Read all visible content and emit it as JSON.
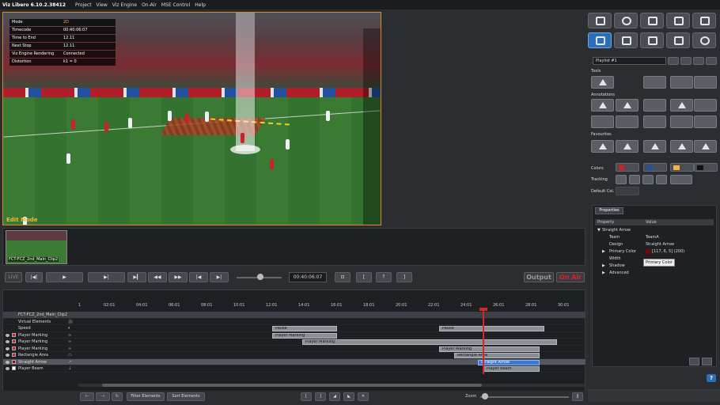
{
  "app": {
    "title": "Viz Libero 6.10.2.38412",
    "menu": [
      "Project",
      "View",
      "Viz Engine",
      "On-Air",
      "MSE Control",
      "Help"
    ]
  },
  "video": {
    "overlay_label": "Edit Mode",
    "info": [
      {
        "key": "Mode",
        "value": "2D"
      },
      {
        "key": "Timecode",
        "value": "00:40:06:07"
      },
      {
        "key": "Time to End",
        "value": "12.11"
      },
      {
        "key": "Next Stop",
        "value": "12.11"
      },
      {
        "key": "Viz Engine Rendering",
        "value": "Connected"
      },
      {
        "key": "Distortion",
        "value": "k1 = 0"
      }
    ]
  },
  "thumbnails": [
    {
      "label": "FCT-FCZ_2nd_Main_Clip2"
    }
  ],
  "transport": {
    "live": "LIVE",
    "timecode": "00:40:06:07",
    "output": "Output",
    "on_air": "On Air"
  },
  "timeline": {
    "ticks": [
      "1",
      "02:01",
      "04:01",
      "06:01",
      "08:01",
      "10:01",
      "12:01",
      "14:01",
      "16:01",
      "18:01",
      "20:01",
      "22:01",
      "24:01",
      "26:01",
      "28:01",
      "30:01"
    ],
    "tracks": [
      {
        "label": "FCT-FCZ_2nd_Main_Clip2",
        "type": "header"
      },
      {
        "label": "Virtual Elements",
        "icon": "🎥"
      },
      {
        "label": "Speed",
        "icon": "⏸"
      },
      {
        "label": "Player Marking",
        "icon": "∞",
        "color": "#c8222a"
      },
      {
        "label": "Player Marking",
        "icon": "∞",
        "color": "#c8222a"
      },
      {
        "label": "Player Marking",
        "icon": "∞",
        "color": "#c8222a"
      },
      {
        "label": "Rectangle Area",
        "icon": "▭",
        "color": "#c8222a"
      },
      {
        "label": "Straight Arrow",
        "icon": "↗",
        "color": "#8b1010",
        "selected": true
      },
      {
        "label": "Player Beam",
        "icon": "⇣",
        "color": "#ffffff"
      }
    ],
    "clips": [
      {
        "track": 2,
        "label": "Pause"
      },
      {
        "track": 2,
        "label": "Pause"
      },
      {
        "track": 3,
        "label": "Player Marking"
      },
      {
        "track": 4,
        "label": "Player Marking"
      },
      {
        "track": 5,
        "label": "Player Marking"
      },
      {
        "track": 6,
        "label": "Rectangle Area"
      },
      {
        "track": 7,
        "label": "Straight Arrow",
        "selected": true
      },
      {
        "track": 8,
        "label": "Player Beam"
      }
    ]
  },
  "bottombar": {
    "filter": "Filter Elements",
    "sort": "Sort Elements",
    "zoom": "Zoom"
  },
  "rpanel": {
    "playlist": "Playlist #1",
    "sections": {
      "tools": "Tools",
      "annotations": "Annotations",
      "favourites": "Favourites",
      "colors": "Colors",
      "tracking": "Tracking",
      "default_col": "Default Col."
    },
    "properties": {
      "tab": "Properties",
      "col_property": "Property",
      "col_value": "Value",
      "rows": [
        {
          "name": "Straight Arrow",
          "value": "",
          "level": 0,
          "expand": "▼"
        },
        {
          "name": "Team",
          "value": "TeamA",
          "level": 1
        },
        {
          "name": "Design",
          "value": "Straight Arrow",
          "level": 1
        },
        {
          "name": "Primary Color",
          "value": "[117, 6, 5] (200)",
          "level": 1,
          "expand": "▶",
          "swatch": "#750605"
        },
        {
          "name": "Width",
          "value": "",
          "level": 1
        },
        {
          "name": "Shadow",
          "value": "",
          "level": 1,
          "expand": "▶"
        },
        {
          "name": "Advanced",
          "value": "",
          "level": 1,
          "expand": "▶"
        }
      ],
      "tooltip": "Primary Color"
    },
    "help": "?"
  }
}
